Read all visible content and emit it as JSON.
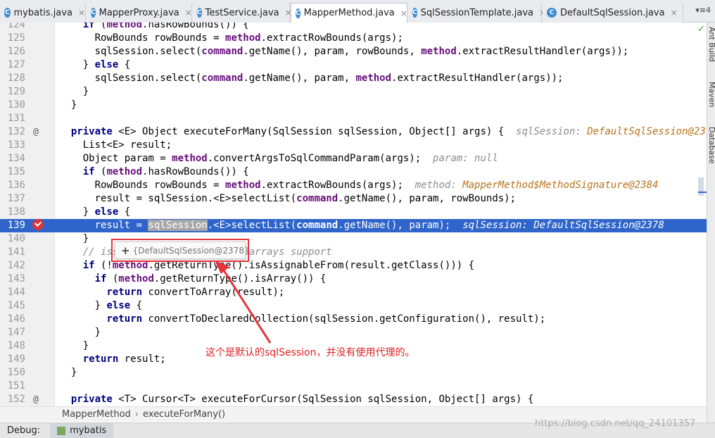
{
  "tabs": [
    {
      "label": "mybatis.java",
      "icon": "C"
    },
    {
      "label": "MapperProxy.java",
      "icon": "C"
    },
    {
      "label": "TestService.java",
      "icon": "C"
    },
    {
      "label": "MapperMethod.java",
      "icon": "C"
    },
    {
      "label": "SqlSessionTemplate.java",
      "icon": "C"
    },
    {
      "label": "DefaultSqlSession.java",
      "icon": "C"
    }
  ],
  "tab_control": "▾≡4",
  "code_lines": [
    {
      "num": "124",
      "html_parts": []
    },
    {
      "num": "125"
    },
    {
      "num": "126"
    },
    {
      "num": "127"
    },
    {
      "num": "128"
    },
    {
      "num": "129"
    },
    {
      "num": "130"
    },
    {
      "num": "131"
    },
    {
      "num": "132"
    },
    {
      "num": "133"
    },
    {
      "num": "134"
    },
    {
      "num": "135"
    },
    {
      "num": "136"
    },
    {
      "num": "137"
    },
    {
      "num": "138"
    },
    {
      "num": "139"
    },
    {
      "num": "140"
    },
    {
      "num": "141"
    },
    {
      "num": "142"
    },
    {
      "num": "143"
    },
    {
      "num": "144"
    },
    {
      "num": "145"
    },
    {
      "num": "146"
    },
    {
      "num": "147"
    },
    {
      "num": "148"
    },
    {
      "num": "149"
    },
    {
      "num": "150"
    },
    {
      "num": "151"
    },
    {
      "num": "152"
    }
  ],
  "tooltip": {
    "plus": "+",
    "text": "{DefaultSqlSession@2378}"
  },
  "annotation": "这个是默认的sqlSession，并没有使用代理的。",
  "breadcrumb": {
    "class_name": "MapperMethod",
    "method_name": "executeForMany()"
  },
  "debug": {
    "label": "Debug:",
    "session": "mybatis"
  },
  "right_tools": [
    "Ant Build",
    "Maven",
    "Database"
  ],
  "watermark": "https://blog.csdn.net/qq_24101357"
}
